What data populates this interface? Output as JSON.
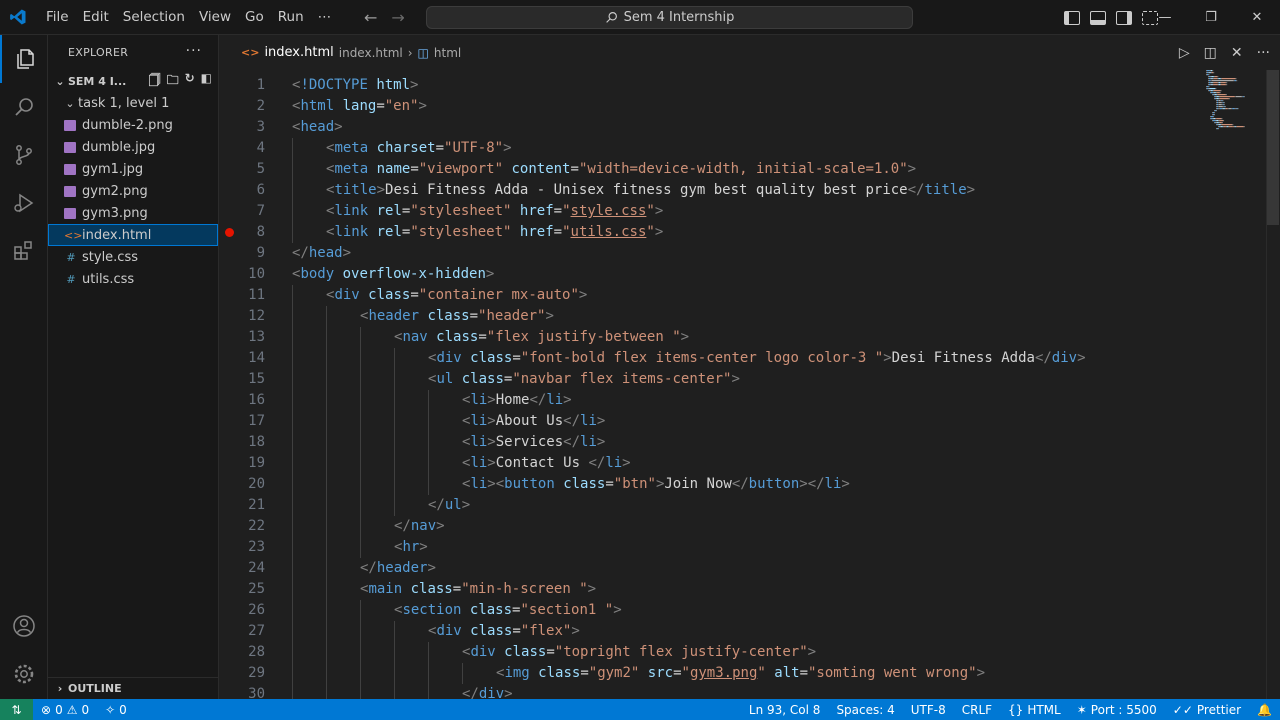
{
  "menu": [
    "File",
    "Edit",
    "Selection",
    "View",
    "Go",
    "Run",
    "⋯"
  ],
  "command_center": "Sem 4 Internship",
  "sidebar": {
    "title": "EXPLORER",
    "folder": "SEM 4 I...",
    "subfolder": "task 1, level 1",
    "files": [
      {
        "name": "dumble-2.png",
        "type": "image"
      },
      {
        "name": "dumble.jpg",
        "type": "image"
      },
      {
        "name": "gym1.jpg",
        "type": "image"
      },
      {
        "name": "gym2.png",
        "type": "image"
      },
      {
        "name": "gym3.png",
        "type": "image"
      },
      {
        "name": "index.html",
        "type": "html",
        "selected": true
      },
      {
        "name": "style.css",
        "type": "css"
      },
      {
        "name": "utils.css",
        "type": "css"
      }
    ],
    "outline": "OUTLINE"
  },
  "editor": {
    "breadcrumb_file": "index.html",
    "breadcrumb_path": "index.html",
    "breadcrumb_node": "html",
    "breakpoint_line": 8,
    "lines": [
      {
        "n": 1,
        "indent": 0,
        "tokens": [
          [
            "p",
            "<"
          ],
          [
            "t",
            "!DOCTYPE"
          ],
          [
            "x",
            " "
          ],
          [
            "a",
            "html"
          ],
          [
            "p",
            ">"
          ]
        ]
      },
      {
        "n": 2,
        "indent": 0,
        "tokens": [
          [
            "p",
            "<"
          ],
          [
            "t",
            "html"
          ],
          [
            "x",
            " "
          ],
          [
            "a",
            "lang"
          ],
          [
            "x",
            "="
          ],
          [
            "s",
            "\"en\""
          ],
          [
            "p",
            ">"
          ]
        ]
      },
      {
        "n": 3,
        "indent": 0,
        "tokens": [
          [
            "p",
            "<"
          ],
          [
            "t",
            "head"
          ],
          [
            "p",
            ">"
          ]
        ]
      },
      {
        "n": 4,
        "indent": 1,
        "tokens": [
          [
            "p",
            "<"
          ],
          [
            "t",
            "meta"
          ],
          [
            "x",
            " "
          ],
          [
            "a",
            "charset"
          ],
          [
            "x",
            "="
          ],
          [
            "s",
            "\"UTF-8\""
          ],
          [
            "p",
            ">"
          ]
        ]
      },
      {
        "n": 5,
        "indent": 1,
        "tokens": [
          [
            "p",
            "<"
          ],
          [
            "t",
            "meta"
          ],
          [
            "x",
            " "
          ],
          [
            "a",
            "name"
          ],
          [
            "x",
            "="
          ],
          [
            "s",
            "\"viewport\""
          ],
          [
            "x",
            " "
          ],
          [
            "a",
            "content"
          ],
          [
            "x",
            "="
          ],
          [
            "s",
            "\"width=device-width, initial-scale=1.0\""
          ],
          [
            "p",
            ">"
          ]
        ]
      },
      {
        "n": 6,
        "indent": 1,
        "tokens": [
          [
            "p",
            "<"
          ],
          [
            "t",
            "title"
          ],
          [
            "p",
            ">"
          ],
          [
            "x",
            "Desi Fitness Adda - Unisex fitness gym best quality best price"
          ],
          [
            "p",
            "</"
          ],
          [
            "t",
            "title"
          ],
          [
            "p",
            ">"
          ]
        ]
      },
      {
        "n": 7,
        "indent": 1,
        "tokens": [
          [
            "p",
            "<"
          ],
          [
            "t",
            "link"
          ],
          [
            "x",
            " "
          ],
          [
            "a",
            "rel"
          ],
          [
            "x",
            "="
          ],
          [
            "s",
            "\"stylesheet\""
          ],
          [
            "x",
            " "
          ],
          [
            "a",
            "href"
          ],
          [
            "x",
            "="
          ],
          [
            "s",
            "\""
          ],
          [
            "su",
            "style.css"
          ],
          [
            "s",
            "\""
          ],
          [
            "p",
            ">"
          ]
        ]
      },
      {
        "n": 8,
        "indent": 1,
        "tokens": [
          [
            "p",
            "<"
          ],
          [
            "t",
            "link"
          ],
          [
            "x",
            " "
          ],
          [
            "a",
            "rel"
          ],
          [
            "x",
            "="
          ],
          [
            "s",
            "\"stylesheet\""
          ],
          [
            "x",
            " "
          ],
          [
            "a",
            "href"
          ],
          [
            "x",
            "="
          ],
          [
            "s",
            "\""
          ],
          [
            "su",
            "utils.css"
          ],
          [
            "s",
            "\""
          ],
          [
            "p",
            ">"
          ]
        ]
      },
      {
        "n": 9,
        "indent": 0,
        "tokens": [
          [
            "p",
            "</"
          ],
          [
            "t",
            "head"
          ],
          [
            "p",
            ">"
          ]
        ]
      },
      {
        "n": 10,
        "indent": 0,
        "tokens": [
          [
            "p",
            "<"
          ],
          [
            "t",
            "body"
          ],
          [
            "x",
            " "
          ],
          [
            "a",
            "overflow-x-hidden"
          ],
          [
            "p",
            ">"
          ]
        ]
      },
      {
        "n": 11,
        "indent": 1,
        "tokens": [
          [
            "p",
            "<"
          ],
          [
            "t",
            "div"
          ],
          [
            "x",
            " "
          ],
          [
            "a",
            "class"
          ],
          [
            "x",
            "="
          ],
          [
            "s",
            "\"container mx-auto\""
          ],
          [
            "p",
            ">"
          ]
        ]
      },
      {
        "n": 12,
        "indent": 2,
        "tokens": [
          [
            "p",
            "<"
          ],
          [
            "t",
            "header"
          ],
          [
            "x",
            " "
          ],
          [
            "a",
            "class"
          ],
          [
            "x",
            "="
          ],
          [
            "s",
            "\"header\""
          ],
          [
            "p",
            ">"
          ]
        ]
      },
      {
        "n": 13,
        "indent": 3,
        "tokens": [
          [
            "p",
            "<"
          ],
          [
            "t",
            "nav"
          ],
          [
            "x",
            " "
          ],
          [
            "a",
            "class"
          ],
          [
            "x",
            "="
          ],
          [
            "s",
            "\"flex justify-between \""
          ],
          [
            "p",
            ">"
          ]
        ]
      },
      {
        "n": 14,
        "indent": 4,
        "tokens": [
          [
            "p",
            "<"
          ],
          [
            "t",
            "div"
          ],
          [
            "x",
            " "
          ],
          [
            "a",
            "class"
          ],
          [
            "x",
            "="
          ],
          [
            "s",
            "\"font-bold flex items-center logo color-3 \""
          ],
          [
            "p",
            ">"
          ],
          [
            "x",
            "Desi Fitness Adda"
          ],
          [
            "p",
            "</"
          ],
          [
            "t",
            "div"
          ],
          [
            "p",
            ">"
          ]
        ]
      },
      {
        "n": 15,
        "indent": 4,
        "tokens": [
          [
            "p",
            "<"
          ],
          [
            "t",
            "ul"
          ],
          [
            "x",
            " "
          ],
          [
            "a",
            "class"
          ],
          [
            "x",
            "="
          ],
          [
            "s",
            "\"navbar flex items-center\""
          ],
          [
            "p",
            ">"
          ]
        ]
      },
      {
        "n": 16,
        "indent": 5,
        "tokens": [
          [
            "p",
            "<"
          ],
          [
            "t",
            "li"
          ],
          [
            "p",
            ">"
          ],
          [
            "x",
            "Home"
          ],
          [
            "p",
            "</"
          ],
          [
            "t",
            "li"
          ],
          [
            "p",
            ">"
          ]
        ]
      },
      {
        "n": 17,
        "indent": 5,
        "tokens": [
          [
            "p",
            "<"
          ],
          [
            "t",
            "li"
          ],
          [
            "p",
            ">"
          ],
          [
            "x",
            "About Us"
          ],
          [
            "p",
            "</"
          ],
          [
            "t",
            "li"
          ],
          [
            "p",
            ">"
          ]
        ]
      },
      {
        "n": 18,
        "indent": 5,
        "tokens": [
          [
            "p",
            "<"
          ],
          [
            "t",
            "li"
          ],
          [
            "p",
            ">"
          ],
          [
            "x",
            "Services"
          ],
          [
            "p",
            "</"
          ],
          [
            "t",
            "li"
          ],
          [
            "p",
            ">"
          ]
        ]
      },
      {
        "n": 19,
        "indent": 5,
        "tokens": [
          [
            "p",
            "<"
          ],
          [
            "t",
            "li"
          ],
          [
            "p",
            ">"
          ],
          [
            "x",
            "Contact Us "
          ],
          [
            "p",
            "</"
          ],
          [
            "t",
            "li"
          ],
          [
            "p",
            ">"
          ]
        ]
      },
      {
        "n": 20,
        "indent": 5,
        "tokens": [
          [
            "p",
            "<"
          ],
          [
            "t",
            "li"
          ],
          [
            "p",
            ">"
          ],
          [
            "p",
            "<"
          ],
          [
            "t",
            "button"
          ],
          [
            "x",
            " "
          ],
          [
            "a",
            "class"
          ],
          [
            "x",
            "="
          ],
          [
            "s",
            "\"btn\""
          ],
          [
            "p",
            ">"
          ],
          [
            "x",
            "Join Now"
          ],
          [
            "p",
            "</"
          ],
          [
            "t",
            "button"
          ],
          [
            "p",
            ">"
          ],
          [
            "p",
            "</"
          ],
          [
            "t",
            "li"
          ],
          [
            "p",
            ">"
          ]
        ]
      },
      {
        "n": 21,
        "indent": 4,
        "tokens": [
          [
            "p",
            "</"
          ],
          [
            "t",
            "ul"
          ],
          [
            "p",
            ">"
          ]
        ]
      },
      {
        "n": 22,
        "indent": 3,
        "tokens": [
          [
            "p",
            "</"
          ],
          [
            "t",
            "nav"
          ],
          [
            "p",
            ">"
          ]
        ]
      },
      {
        "n": 23,
        "indent": 3,
        "tokens": [
          [
            "p",
            "<"
          ],
          [
            "t",
            "hr"
          ],
          [
            "p",
            ">"
          ]
        ]
      },
      {
        "n": 24,
        "indent": 2,
        "tokens": [
          [
            "p",
            "</"
          ],
          [
            "t",
            "header"
          ],
          [
            "p",
            ">"
          ]
        ]
      },
      {
        "n": 25,
        "indent": 2,
        "tokens": [
          [
            "p",
            "<"
          ],
          [
            "t",
            "main"
          ],
          [
            "x",
            " "
          ],
          [
            "a",
            "class"
          ],
          [
            "x",
            "="
          ],
          [
            "s",
            "\"min-h-screen \""
          ],
          [
            "p",
            ">"
          ]
        ]
      },
      {
        "n": 26,
        "indent": 3,
        "tokens": [
          [
            "p",
            "<"
          ],
          [
            "t",
            "section"
          ],
          [
            "x",
            " "
          ],
          [
            "a",
            "class"
          ],
          [
            "x",
            "="
          ],
          [
            "s",
            "\"section1 \""
          ],
          [
            "p",
            ">"
          ]
        ]
      },
      {
        "n": 27,
        "indent": 4,
        "tokens": [
          [
            "p",
            "<"
          ],
          [
            "t",
            "div"
          ],
          [
            "x",
            " "
          ],
          [
            "a",
            "class"
          ],
          [
            "x",
            "="
          ],
          [
            "s",
            "\"flex\""
          ],
          [
            "p",
            ">"
          ]
        ]
      },
      {
        "n": 28,
        "indent": 5,
        "tokens": [
          [
            "p",
            "<"
          ],
          [
            "t",
            "div"
          ],
          [
            "x",
            " "
          ],
          [
            "a",
            "class"
          ],
          [
            "x",
            "="
          ],
          [
            "s",
            "\"topright flex justify-center\""
          ],
          [
            "p",
            ">"
          ]
        ]
      },
      {
        "n": 29,
        "indent": 6,
        "tokens": [
          [
            "p",
            "<"
          ],
          [
            "t",
            "img"
          ],
          [
            "x",
            " "
          ],
          [
            "a",
            "class"
          ],
          [
            "x",
            "="
          ],
          [
            "s",
            "\"gym2\""
          ],
          [
            "x",
            " "
          ],
          [
            "a",
            "src"
          ],
          [
            "x",
            "="
          ],
          [
            "s",
            "\""
          ],
          [
            "su",
            "gym3.png"
          ],
          [
            "s",
            "\""
          ],
          [
            "x",
            " "
          ],
          [
            "a",
            "alt"
          ],
          [
            "x",
            "="
          ],
          [
            "s",
            "\"somting went wrong\""
          ],
          [
            "p",
            ">"
          ]
        ]
      },
      {
        "n": 30,
        "indent": 5,
        "tokens": [
          [
            "p",
            "</"
          ],
          [
            "t",
            "div"
          ],
          [
            "p",
            ">"
          ]
        ]
      }
    ]
  },
  "status": {
    "errors": "0",
    "warnings": "0",
    "ports": "0",
    "position": "Ln 93, Col 8",
    "spaces": "Spaces: 4",
    "encoding": "UTF-8",
    "eol": "CRLF",
    "language": "HTML",
    "port": "Port : 5500",
    "formatter": "Prettier"
  },
  "colors": {
    "accent": "#0078d4",
    "remote": "#16825d",
    "breakpoint": "#e51400"
  }
}
